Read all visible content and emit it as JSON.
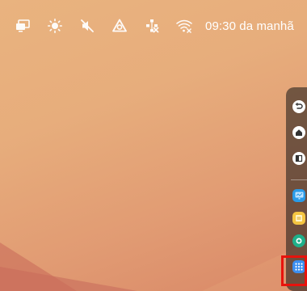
{
  "status_bar": {
    "time": "09:30 da manhã",
    "icons": [
      "screen-mirror-icon",
      "brightness-icon",
      "volume-muted-icon",
      "sync-icon",
      "ethernet-disconnected-icon",
      "wifi-no-internet-icon"
    ]
  },
  "side_toolbar": {
    "buttons": [
      "back-icon",
      "home-icon",
      "recents-icon"
    ],
    "apps": [
      "whiteboard-app-icon",
      "notes-app-icon",
      "browser-app-icon",
      "app-drawer-icon"
    ]
  },
  "highlight": {
    "color": "#e8120c"
  },
  "colors": {
    "wallpaper_top": "#e9b37f",
    "wallpaper_bottom": "#d98867",
    "whiteboard_app": "#2a9be8",
    "notes_app": "#f5c542",
    "browser_app": "#1fb08a",
    "app_drawer": "#3b8ef0"
  }
}
